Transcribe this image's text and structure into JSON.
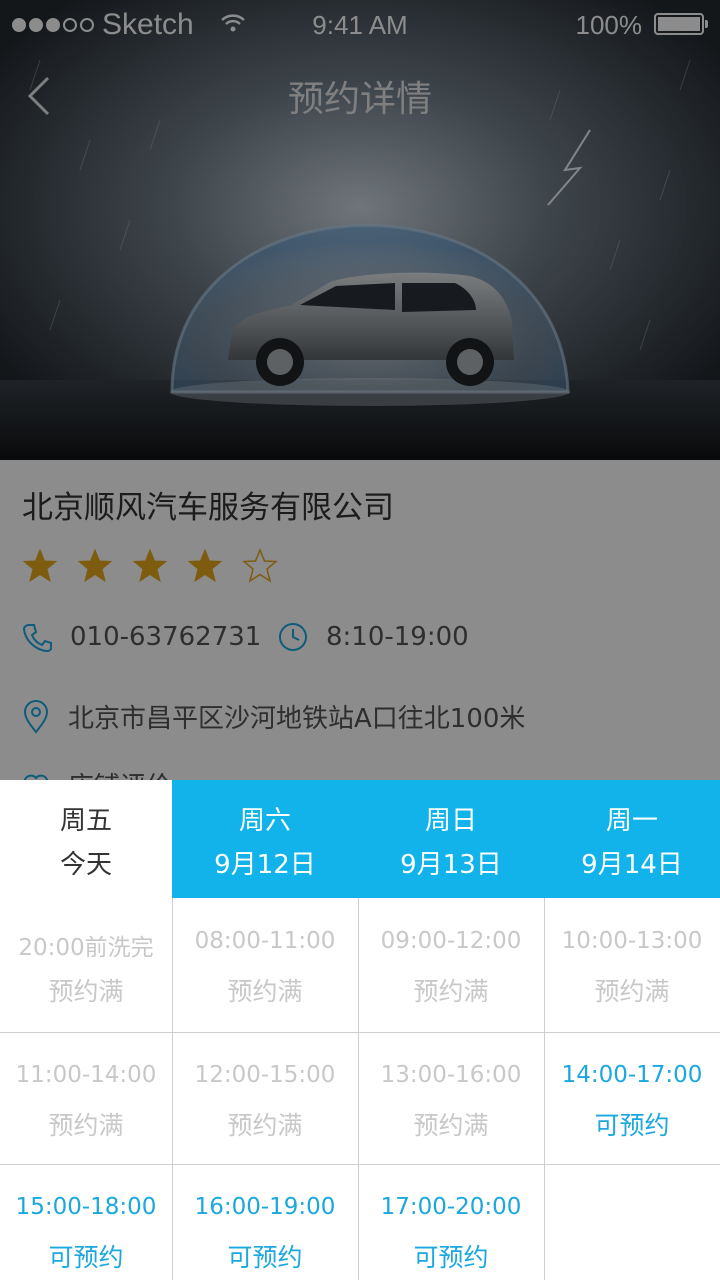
{
  "status_bar": {
    "carrier": "Sketch",
    "time": "9:41 AM",
    "battery": "100%",
    "battery_level": 1.0
  },
  "nav": {
    "title": "预约详情"
  },
  "shop": {
    "name": "北京顺风汽车服务有限公司",
    "rating": 4,
    "rating_max": 5,
    "phone": "010-63762731",
    "hours": "8:10-19:00",
    "address": "北京市昌平区沙河地铁站A口往北100米",
    "more_label": "店铺评价"
  },
  "colors": {
    "accent": "#12b3ea",
    "available_text": "#1ba8de",
    "full_text": "#c8c8c8",
    "star": "#e3a81c"
  },
  "days": [
    {
      "weekday": "周五",
      "date": "今天",
      "active": true
    },
    {
      "weekday": "周六",
      "date": "9月12日",
      "active": false
    },
    {
      "weekday": "周日",
      "date": "9月13日",
      "active": false
    },
    {
      "weekday": "周一",
      "date": "9月14日",
      "active": false
    }
  ],
  "slots": [
    [
      {
        "time": "20:00前洗完",
        "status": "预约满"
      },
      {
        "time": "08:00-11:00",
        "status": "预约满"
      },
      {
        "time": "09:00-12:00",
        "status": "预约满"
      },
      {
        "time": "10:00-13:00",
        "status": "预约满"
      }
    ],
    [
      {
        "time": "11:00-14:00",
        "status": "预约满"
      },
      {
        "time": "12:00-15:00",
        "status": "预约满"
      },
      {
        "time": "13:00-16:00",
        "status": "预约满"
      },
      {
        "time": "14:00-17:00",
        "status": "可预约"
      }
    ],
    [
      {
        "time": "15:00-18:00",
        "status": "可预约"
      },
      {
        "time": "16:00-19:00",
        "status": "可预约"
      },
      {
        "time": "17:00-20:00",
        "status": "可预约"
      },
      {
        "time": "",
        "status": ""
      }
    ]
  ]
}
